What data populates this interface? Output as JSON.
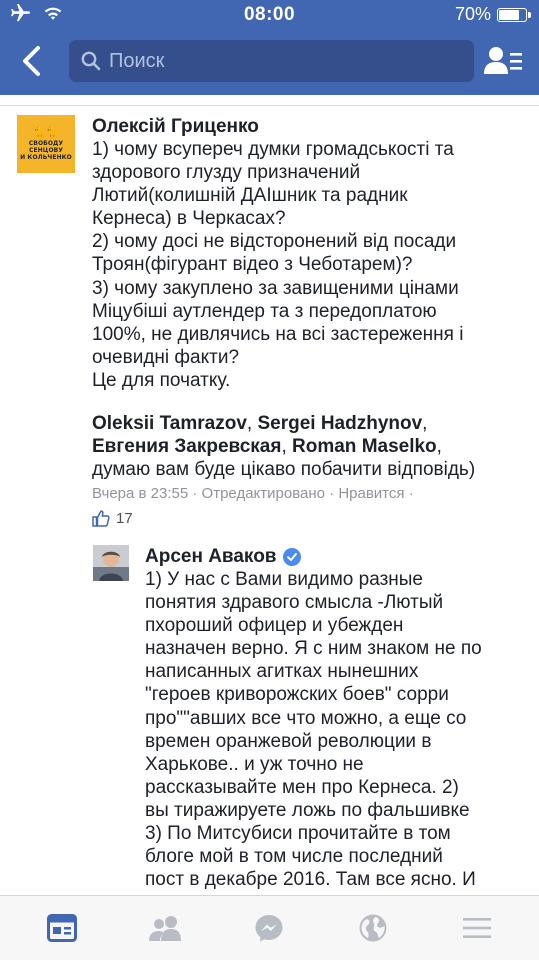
{
  "status_bar": {
    "time": "08:00",
    "battery_label": "70%",
    "battery_level": 0.7
  },
  "header": {
    "search_placeholder": "Поиск"
  },
  "comment": {
    "author": "Олексій Гриценко",
    "avatar_lines": [
      "СВОБОДУ",
      "СЕНЦОВУ",
      "И КОЛЬЧЕНКО"
    ],
    "text_lines": [
      "1) чому всупереч думки громадськості та",
      "здорового глузду призначений",
      "Лютий(колишній ДАІшник та радник",
      "Кернеса) в Черкасах?",
      "2) чому досі не відсторонений від посади",
      "Троян(фігурант відео з Чеботарем)?",
      "3) чому закуплено за завищеними цінами",
      "Міцубіші аутлендер та з передоплатою",
      "100%, не дивлячись на всі застереження і",
      "очевидні факти?",
      "Це для початку."
    ],
    "tagged": [
      "Oleksii Tamrazov",
      "Sergei Hadzhynov",
      "Евгения Закревская",
      "Roman Maselko"
    ],
    "tag_tail": "думаю вам буде цікаво побачити відповідь)",
    "meta": {
      "time": "Вчера в 23:55",
      "edited": "Отредактировано",
      "like": "Нравится"
    },
    "likes_count": "17"
  },
  "reply": {
    "author": "Арсен Аваков",
    "text_lines": [
      "1) У нас с Вами видимо разные",
      "понятия здравого смысла -Лютый",
      "пхороший офицер и убежден",
      "назначен верно. Я с ним знаком не по",
      "написанных агитках нынешних",
      "\"героев криворожских боев\" сорри",
      "про\"\"авших все что можно, а еще со",
      "времен оранжевой революции в",
      "Харькове.. и уж точно не",
      "рассказывайте мен про Кернеса.  2)",
      "вы тиражируете ложь по фальшивке",
      "3) По Митсубиси прочитайте в том",
      "блоге мой в том числе последний",
      "пост в декабре 2016. Там все ясно. И"
    ]
  },
  "tabbar": {
    "active": "news-feed",
    "tabs": [
      "news-feed",
      "friends",
      "messenger",
      "notifications",
      "menu"
    ]
  },
  "colors": {
    "brand": "#4267b2",
    "search_bg": "#344f8c",
    "active_tab": "#4267b2",
    "inactive_tab": "#b8bcc4",
    "meta_text": "#90949c"
  }
}
